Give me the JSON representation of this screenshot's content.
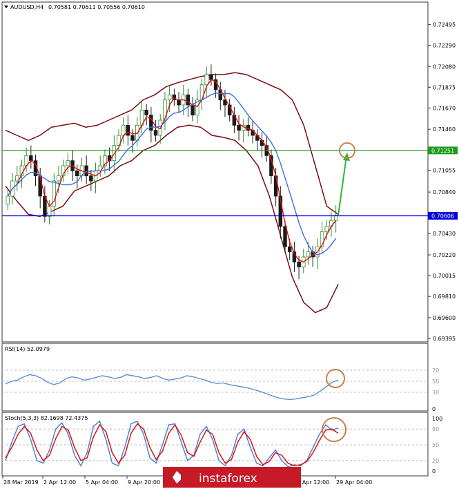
{
  "header": {
    "symbol": "AUDUSD,H4",
    "ohlc": "0.70581 0.70611 0.70556 0.70610"
  },
  "price_panel": {
    "y_ticks": [
      "0.72495",
      "0.72290",
      "0.72080",
      "0.71875",
      "0.71670",
      "0.71460",
      "0.71055",
      "0.70840",
      "0.70430",
      "0.70220",
      "0.70015",
      "0.69810",
      "0.69600",
      "0.69395"
    ],
    "resistance_label": "0.71251",
    "support_label": "0.70606"
  },
  "rsi_panel": {
    "title": "RSI(14) 52.0979",
    "levels": [
      "70",
      "50",
      "30",
      "0"
    ]
  },
  "stoch_panel": {
    "title": "Stoch(5,3,3) 82.1698 72.4375",
    "levels": [
      "100",
      "80",
      "50",
      "20",
      "0"
    ]
  },
  "x_ticks": [
    "28 Mar 2019",
    "2 Apr 12:00",
    "5 Apr 04:00",
    "9 Apr 20:00",
    "24 Apr 12:00",
    "29 Apr 04:00"
  ],
  "watermark": "instaforex",
  "colors": {
    "bull": "#2e8b2e",
    "bear": "#1a1a1a",
    "bands": "#7b0c0c",
    "ma_fast": "#e01010",
    "ma_slow": "#3a6fd8",
    "resistance": "#1e9a1e",
    "support": "#0000dd",
    "rsi": "#5b8fd8",
    "stoch_main": "#4a86d8",
    "stoch_signal": "#e01010",
    "marker": "#c8804a",
    "arrow": "#2fb52f"
  },
  "chart_data": [
    {
      "type": "candlestick",
      "title": "AUDUSD,H4",
      "ylim": [
        0.69395,
        0.726
      ],
      "horizontal_lines": [
        0.71251,
        0.70606
      ],
      "x_labels": [
        "28 Mar 2019",
        "2 Apr 12:00",
        "5 Apr 04:00",
        "9 Apr 20:00",
        "24 Apr 12:00",
        "29 Apr 04:00"
      ],
      "close_path": [
        0.708,
        0.7095,
        0.71,
        0.711,
        0.712,
        0.7115,
        0.71,
        0.708,
        0.706,
        0.707,
        0.7095,
        0.71,
        0.711,
        0.7115,
        0.7105,
        0.71,
        0.711,
        0.71,
        0.7095,
        0.7105,
        0.711,
        0.712,
        0.7115,
        0.713,
        0.714,
        0.715,
        0.714,
        0.7135,
        0.715,
        0.7165,
        0.716,
        0.7145,
        0.714,
        0.7155,
        0.7175,
        0.718,
        0.7175,
        0.717,
        0.718,
        0.717,
        0.716,
        0.7175,
        0.719,
        0.72,
        0.7195,
        0.7185,
        0.7175,
        0.717,
        0.716,
        0.715,
        0.7145,
        0.715,
        0.7145,
        0.714,
        0.7135,
        0.713,
        0.712,
        0.71,
        0.708,
        0.705,
        0.703,
        0.7025,
        0.7015,
        0.701,
        0.702,
        0.7025,
        0.702,
        0.703,
        0.7045,
        0.705,
        0.7056,
        0.7061
      ],
      "bands_upper": [
        0.7145,
        0.714,
        0.7135,
        0.714,
        0.7148,
        0.715,
        0.7152,
        0.7148,
        0.715,
        0.7155,
        0.716,
        0.7165,
        0.7175,
        0.718,
        0.7188,
        0.7192,
        0.7195,
        0.7198,
        0.72,
        0.72,
        0.7202,
        0.72,
        0.7195,
        0.719,
        0.7185,
        0.7175,
        0.715,
        0.711,
        0.707,
        0.7062
      ],
      "bands_lower": [
        0.709,
        0.7075,
        0.7062,
        0.706,
        0.7065,
        0.707,
        0.7085,
        0.709,
        0.7095,
        0.71,
        0.711,
        0.7115,
        0.7125,
        0.713,
        0.714,
        0.7148,
        0.715,
        0.7148,
        0.714,
        0.7138,
        0.7135,
        0.7125,
        0.711,
        0.708,
        0.704,
        0.7,
        0.6975,
        0.6965,
        0.697,
        0.6993
      ],
      "projection": {
        "from": 0.7061,
        "to": 0.7125
      }
    },
    {
      "type": "line",
      "title": "RSI(14) 52.0979",
      "ylim": [
        0,
        100
      ],
      "levels": [
        70,
        50,
        30
      ],
      "values": [
        45,
        50,
        52,
        58,
        62,
        60,
        55,
        48,
        44,
        47,
        55,
        58,
        56,
        52,
        54,
        57,
        60,
        58,
        55,
        57,
        62,
        60,
        58,
        55,
        57,
        60,
        55,
        52,
        54,
        56,
        60,
        58,
        55,
        52,
        48,
        46,
        47,
        44,
        42,
        40,
        38,
        35,
        32,
        28,
        24,
        20,
        18,
        17,
        18,
        20,
        22,
        25,
        32,
        40,
        48,
        52
      ]
    },
    {
      "type": "line",
      "title": "Stoch(5,3,3) 82.1698 72.4375",
      "ylim": [
        0,
        100
      ],
      "levels": [
        80,
        50,
        20
      ],
      "series": [
        {
          "values": [
            20,
            55,
            85,
            90,
            60,
            20,
            15,
            40,
            80,
            92,
            70,
            30,
            10,
            35,
            85,
            95,
            60,
            15,
            10,
            45,
            90,
            95,
            70,
            25,
            15,
            50,
            88,
            90,
            55,
            20,
            30,
            70,
            85,
            60,
            20,
            10,
            30,
            70,
            80,
            45,
            15,
            10,
            25,
            40,
            20,
            8,
            12,
            10,
            20,
            45,
            70,
            88,
            78,
            82
          ]
        },
        {
          "values": [
            25,
            45,
            70,
            85,
            72,
            40,
            20,
            30,
            62,
            85,
            78,
            45,
            20,
            25,
            65,
            88,
            75,
            35,
            15,
            30,
            72,
            90,
            80,
            45,
            22,
            38,
            72,
            88,
            68,
            35,
            28,
            55,
            78,
            70,
            35,
            15,
            22,
            55,
            75,
            60,
            28,
            12,
            18,
            35,
            30,
            15,
            10,
            12,
            18,
            35,
            58,
            78,
            80,
            72
          ]
        }
      ]
    }
  ]
}
